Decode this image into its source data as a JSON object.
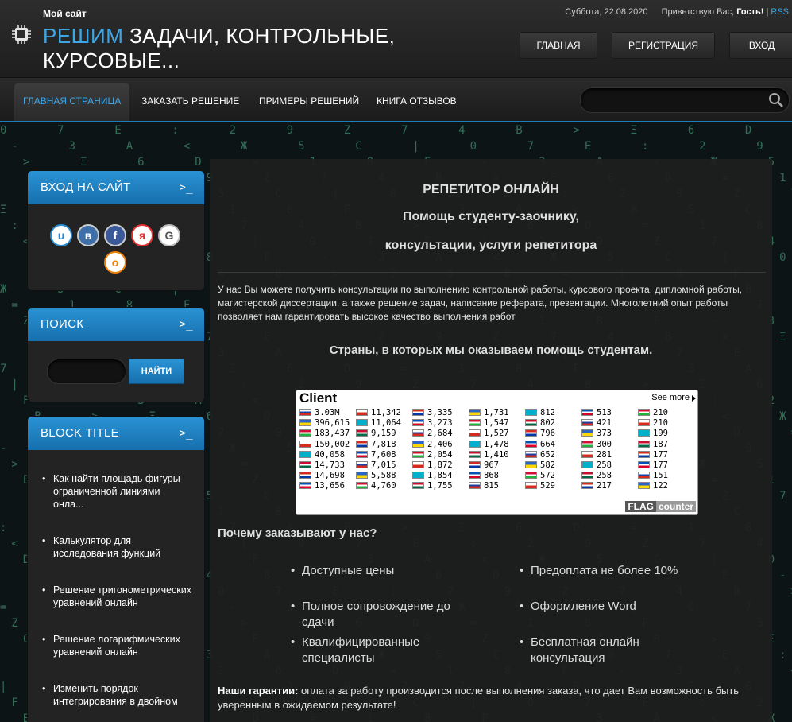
{
  "header": {
    "site_small": "Мой сайт",
    "logo_accent": "РЕШИМ",
    "logo_rest": " ЗАДАЧИ, КОНТРОЛЬНЫЕ, КУРСОВЫЕ...",
    "date": "Суббота, 22.08.2020",
    "greeting": "Приветствую Вас,",
    "user": "Гость!",
    "sep": "|",
    "rss": "RSS",
    "buttons": [
      "ГЛАВНАЯ",
      "РЕГИСТРАЦИЯ",
      "ВХОД"
    ]
  },
  "nav": {
    "items": [
      "ГЛАВНАЯ СТРАНИЦА",
      "ЗАКАЗАТЬ РЕШЕНИЕ",
      "ПРИМЕРЫ РЕШЕНИЙ",
      "КНИГА ОТЗЫВОВ"
    ],
    "search_placeholder": ""
  },
  "sidebar": {
    "login": {
      "title": "ВХОД НА САЙТ",
      "prompt": ">_",
      "socials": [
        "u",
        "в",
        "f",
        "я",
        "G",
        "о"
      ]
    },
    "search": {
      "title": "ПОИСК",
      "prompt": ">_",
      "button": "НАЙТИ",
      "placeholder": ""
    },
    "block": {
      "title": "BLOCK TITLE",
      "prompt": ">_",
      "items": [
        "Как найти площадь фигуры ограниченной линиями онла...",
        "Калькулятор для исследования функций",
        "Решение тригонометрических уравнений онлайн",
        "Решение логарифмических уравнений онлайн",
        "Изменить порядок интегрирования в двойном"
      ]
    }
  },
  "main": {
    "title1": "РЕПЕТИТОР ОНЛАЙН",
    "title2": "Помощь студенту-заочнику,",
    "title3": "консультации, услуги репетитора",
    "intro": "У нас Вы можете получить консультации по выполнению контрольной работы, курсового проекта, дипломной работы, магистерской диссертации, а также решение задач, написание реферата, презентации. Многолетний опыт работы позволяет нам гарантировать высокое качество выполнения работ",
    "countries_title": "Страны, в которых мы оказываем помощь студентам.",
    "flag_counter": {
      "title": "Client",
      "more": "See more",
      "logo1": "FLAG",
      "logo2": "counter",
      "columns": [
        [
          "3.03M",
          "396,615",
          "183,437",
          "150,002",
          "40,058",
          "14,733",
          "14,698",
          "13,656"
        ],
        [
          "11,342",
          "11,064",
          "9,159",
          "7,818",
          "7,608",
          "7,015",
          "5,588",
          "4,760"
        ],
        [
          "3,335",
          "3,273",
          "2,684",
          "2,406",
          "2,054",
          "1,872",
          "1,854",
          "1,755"
        ],
        [
          "1,731",
          "1,547",
          "1,527",
          "1,478",
          "1,410",
          "967",
          "868",
          "815"
        ],
        [
          "812",
          "802",
          "796",
          "664",
          "652",
          "582",
          "572",
          "529"
        ],
        [
          "513",
          "421",
          "373",
          "300",
          "281",
          "258",
          "258",
          "217"
        ],
        [
          "210",
          "210",
          "199",
          "187",
          "177",
          "177",
          "151",
          "122"
        ]
      ]
    },
    "why_title": "Почему заказывают у нас?",
    "features": [
      "Доступные цены",
      "Предоплата не более 10%",
      "Полное сопровождение до сдачи",
      "Оформление Word",
      "Квалифицированные специалисты",
      "Бесплатная онлайн консультация"
    ],
    "guarantee_label": "Наши гарантии:",
    "guarantee_text": " оплата за работу производится после выполнения заказа, что дает Вам возможность быть уверенным в ожидаемом результате!"
  },
  "colors": {
    "accent": "#3fa6e6",
    "widget_head": "#1f84c6",
    "matrix": "#3d8a6a"
  }
}
